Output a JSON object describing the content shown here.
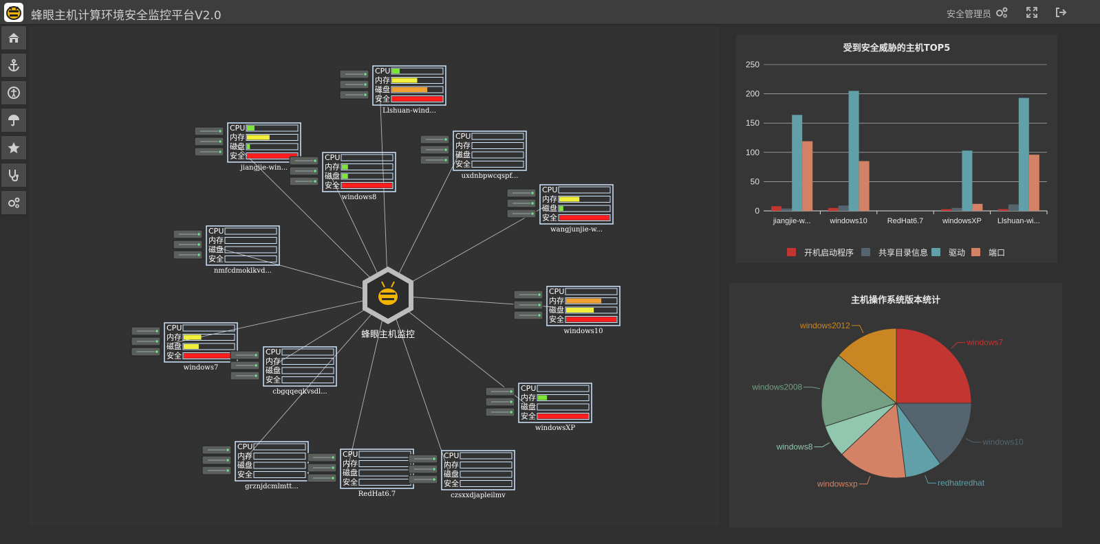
{
  "header": {
    "title": "蜂眼主机计算环境安全监控平台V2.0",
    "user": "安全管理员",
    "icons": [
      "settings-icon",
      "fullscreen-icon",
      "logout-icon"
    ]
  },
  "sidebar": {
    "items": [
      "home-icon",
      "anchor-icon",
      "accessibility-icon",
      "umbrella-icon",
      "star-icon",
      "stethoscope-icon",
      "settings-icon"
    ]
  },
  "topology": {
    "center_label": "蜂眼主机监控",
    "metric_labels": [
      "CPU",
      "内存",
      "磁盘",
      "安全"
    ],
    "colors": {
      "green": "#7ee33a",
      "yellow": "#f0ef3c",
      "orange": "#f0a030",
      "red": "#ff1e1e",
      "frame": "#cfe8ff"
    },
    "hosts": [
      {
        "name": "Llshuan-wind...",
        "metrics": [
          0.15,
          0.5,
          0.7,
          1.0
        ],
        "colors": [
          "green",
          "yellow",
          "orange",
          "red"
        ]
      },
      {
        "name": "jiangjie-win...",
        "metrics": [
          0.15,
          0.45,
          0.06,
          1.0
        ],
        "colors": [
          "green",
          "yellow",
          "green",
          "red"
        ]
      },
      {
        "name": "windows8",
        "metrics": [
          0,
          0.12,
          0.12,
          1.0
        ],
        "colors": [
          "green",
          "green",
          "green",
          "red"
        ]
      },
      {
        "name": "uxdnbpwcqspf...",
        "metrics": [
          0,
          0,
          0,
          0
        ],
        "colors": [
          "green",
          "green",
          "green",
          "red"
        ]
      },
      {
        "name": "wangjunjie-w...",
        "metrics": [
          0,
          0.4,
          0.08,
          1.0
        ],
        "colors": [
          "green",
          "yellow",
          "green",
          "red"
        ]
      },
      {
        "name": "nmfcdmoklkvd...",
        "metrics": [
          0,
          0,
          0,
          0
        ],
        "colors": [
          "green",
          "green",
          "green",
          "red"
        ]
      },
      {
        "name": "windows10",
        "metrics": [
          0,
          0.7,
          0.55,
          1.0
        ],
        "colors": [
          "green",
          "orange",
          "yellow",
          "red"
        ]
      },
      {
        "name": "windows7",
        "metrics": [
          0,
          0.35,
          0.3,
          1.0
        ],
        "colors": [
          "green",
          "yellow",
          "yellow",
          "red"
        ]
      },
      {
        "name": "cbgqqeqkvsdl...",
        "metrics": [
          0,
          0,
          0,
          0
        ],
        "colors": [
          "green",
          "green",
          "green",
          "red"
        ]
      },
      {
        "name": "windowsXP",
        "metrics": [
          0,
          0.18,
          0,
          1.0
        ],
        "colors": [
          "green",
          "green",
          "green",
          "red"
        ]
      },
      {
        "name": "grznjdcmlmtt...",
        "metrics": [
          0,
          0,
          0,
          0
        ],
        "colors": [
          "green",
          "green",
          "green",
          "red"
        ]
      },
      {
        "name": "RedHat6.7",
        "metrics": [
          0,
          0,
          0,
          0
        ],
        "colors": [
          "green",
          "green",
          "green",
          "red"
        ]
      },
      {
        "name": "czsxxdjapleilmv",
        "metrics": [
          0,
          0,
          0,
          0
        ],
        "colors": [
          "green",
          "green",
          "green",
          "red"
        ]
      }
    ]
  },
  "chart_data": [
    {
      "type": "bar",
      "title": "受到安全威胁的主机TOP5",
      "categories": [
        "jiangjie-w...",
        "windows10",
        "RedHat6.7",
        "windowsXP",
        "Llshuan-wi..."
      ],
      "series": [
        {
          "name": "开机启动程序",
          "color": "#c23531",
          "values": [
            8,
            5,
            0,
            3,
            3
          ]
        },
        {
          "name": "共享目录信息",
          "color": "#546570",
          "values": [
            4,
            9,
            0,
            5,
            11
          ]
        },
        {
          "name": "驱动",
          "color": "#61a0a8",
          "values": [
            164,
            205,
            0,
            103,
            193
          ]
        },
        {
          "name": "端口",
          "color": "#d48265",
          "values": [
            119,
            85,
            0,
            12,
            96
          ]
        }
      ],
      "ylim": [
        0,
        250
      ],
      "yticks": [
        0,
        50,
        100,
        150,
        200,
        250
      ],
      "grid": true,
      "legend": "bottom"
    },
    {
      "type": "pie",
      "title": "主机操作系统版本统计",
      "slices": [
        {
          "label": "windows7",
          "value": 25,
          "color": "#c23531"
        },
        {
          "label": "windows10",
          "value": 15,
          "color": "#546570"
        },
        {
          "label": "redhatredhat",
          "value": 8,
          "color": "#61a0a8"
        },
        {
          "label": "windowsxp",
          "value": 15,
          "color": "#d48265"
        },
        {
          "label": "windows8",
          "value": 7,
          "color": "#91c7ae"
        },
        {
          "label": "windows2008",
          "value": 16,
          "color": "#749f83"
        },
        {
          "label": "windows2012",
          "value": 14,
          "color": "#ca8622"
        }
      ],
      "legend": "none"
    }
  ]
}
